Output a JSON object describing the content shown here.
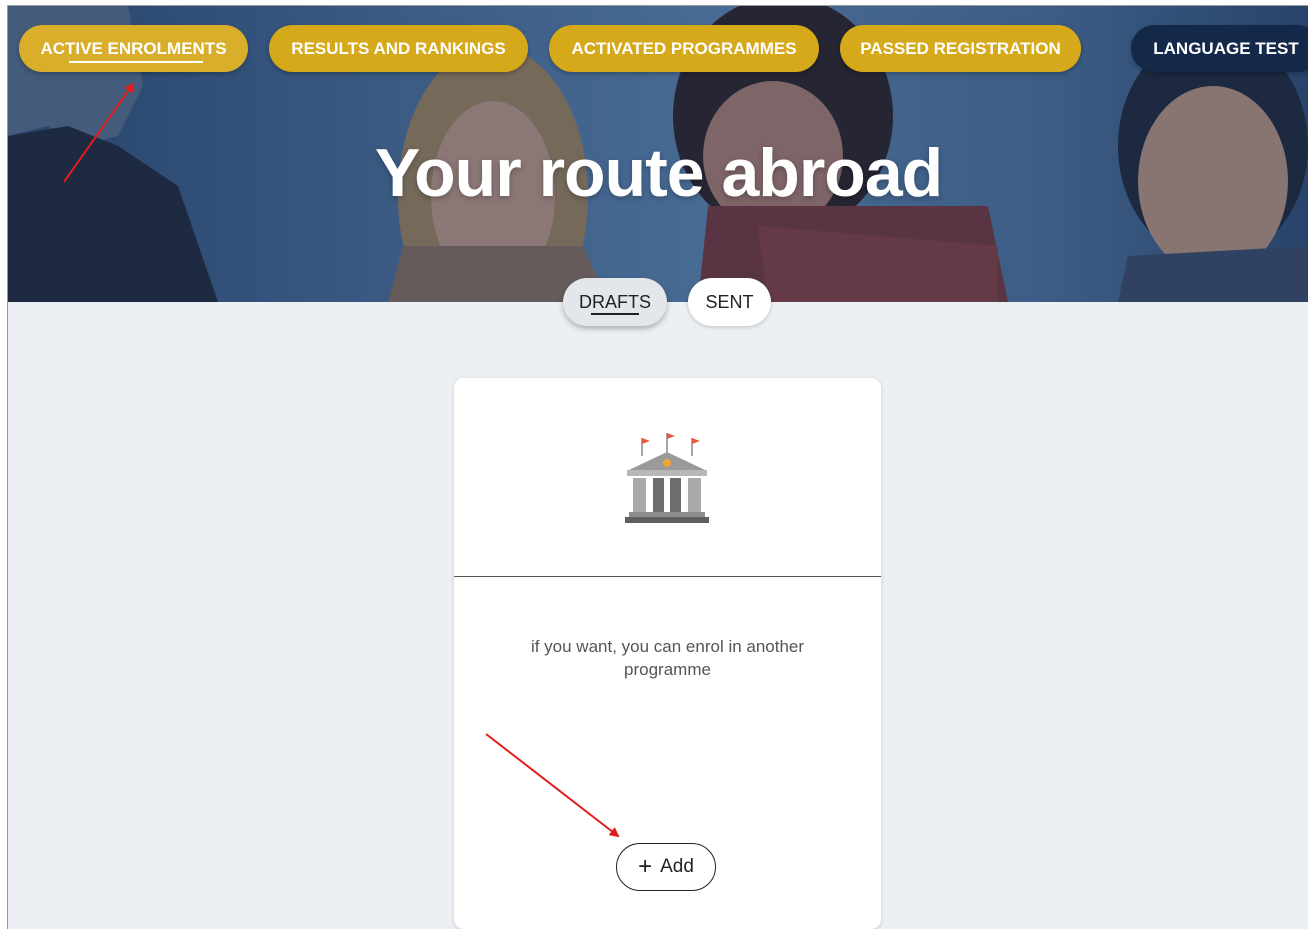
{
  "hero": {
    "title": "Your route abroad"
  },
  "nav": {
    "items": [
      {
        "label": "ACTIVE ENROLMENTS",
        "active": true
      },
      {
        "label": "RESULTS AND RANKINGS"
      },
      {
        "label": "ACTIVATED PROGRAMMES"
      },
      {
        "label": "PASSED REGISTRATION"
      },
      {
        "label": "LANGUAGE TEST"
      }
    ]
  },
  "tabs": {
    "drafts": "DRAFTS",
    "sent": "SENT",
    "selected": "DRAFTS"
  },
  "card": {
    "icon": "university-building-icon",
    "message": "if you want, you can enrol in another programme",
    "add_label": "Add",
    "add_icon": "plus-icon"
  },
  "colors": {
    "nav_pill": "#d6a91b",
    "nav_pill_dark": "#14294a",
    "annotation_arrow": "#e41b1b",
    "page_background": "#eceff3"
  }
}
